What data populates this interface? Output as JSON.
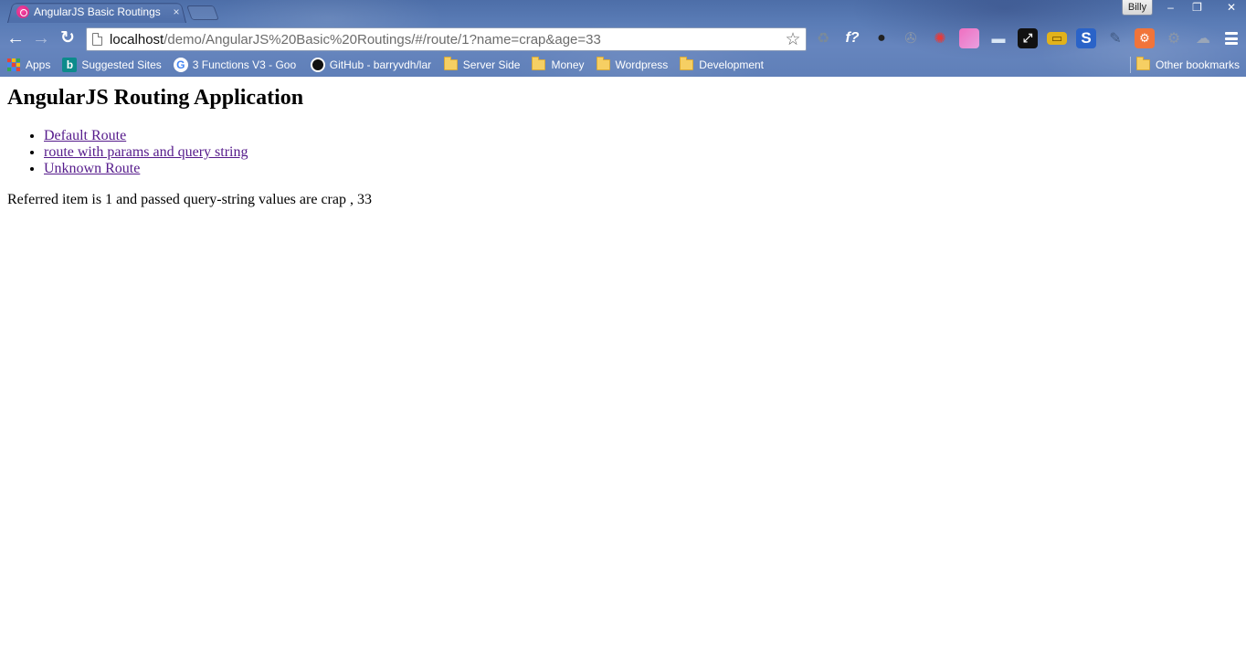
{
  "browser": {
    "tab_title": "AngularJS Basic Routings",
    "tab_close": "×",
    "profile_name": "Billy",
    "window_controls": {
      "minimize": "–",
      "restore": "❐",
      "close": "✕"
    },
    "nav": {
      "back": "←",
      "forward": "→",
      "reload": "↻"
    },
    "url_host": "localhost",
    "url_path": "/demo/AngularJS%20Basic%20Routings/#/route/1?name=crap&age=33",
    "star": "☆",
    "extensions": [
      {
        "icon": "recycle-icon",
        "glyph": "♻",
        "color": "#7a8a9a"
      },
      {
        "icon": "font-finder-icon",
        "glyph": "f?",
        "color": "#1b2a48"
      },
      {
        "icon": "color-wheel-icon",
        "glyph": "●",
        "color": "#222222"
      },
      {
        "icon": "film-reel-icon",
        "glyph": "✇",
        "color": "#8895a8"
      },
      {
        "icon": "color-picker-icon",
        "glyph": "✺",
        "color": "#e53b3b"
      },
      {
        "icon": "gradient-icon",
        "glyph": "",
        "color": "#e06ad0"
      },
      {
        "icon": "window-resizer-icon",
        "glyph": "▬",
        "color": "#d9e6f5"
      },
      {
        "icon": "fullscreen-icon",
        "glyph": "⤢",
        "color": "#111111"
      },
      {
        "icon": "ruler-icon",
        "glyph": "▭",
        "color": "#e2b21b"
      },
      {
        "icon": "stylish-icon",
        "glyph": "S",
        "color": "#2a63c8"
      },
      {
        "icon": "eyedropper-icon",
        "glyph": "✎",
        "color": "#415a82"
      },
      {
        "icon": "hubspot-icon",
        "glyph": "⚙",
        "color": "#f1743a"
      },
      {
        "icon": "gear-icon",
        "glyph": "⚙",
        "color": "#8a96a8"
      },
      {
        "icon": "cloud-icon",
        "glyph": "☁",
        "color": "#9aa6b8"
      }
    ]
  },
  "bookmarks": {
    "items": [
      {
        "label": "Apps",
        "icon": "apps-grid-icon"
      },
      {
        "label": "Suggested Sites",
        "icon": "bing-icon"
      },
      {
        "label": "3 Functions V3 - Goo",
        "icon": "google-icon"
      },
      {
        "label": "GitHub - barryvdh/lar",
        "icon": "github-icon"
      },
      {
        "label": "Server Side",
        "icon": "folder-icon"
      },
      {
        "label": "Money",
        "icon": "folder-icon"
      },
      {
        "label": "Wordpress",
        "icon": "folder-icon"
      },
      {
        "label": "Development",
        "icon": "folder-icon"
      }
    ],
    "other": "Other bookmarks"
  },
  "page": {
    "heading": "AngularJS Routing Application",
    "links": [
      "Default Route",
      "route with params and query string",
      "Unknown Route"
    ],
    "result_text": "Referred item is 1 and passed query-string values are crap , 33"
  }
}
